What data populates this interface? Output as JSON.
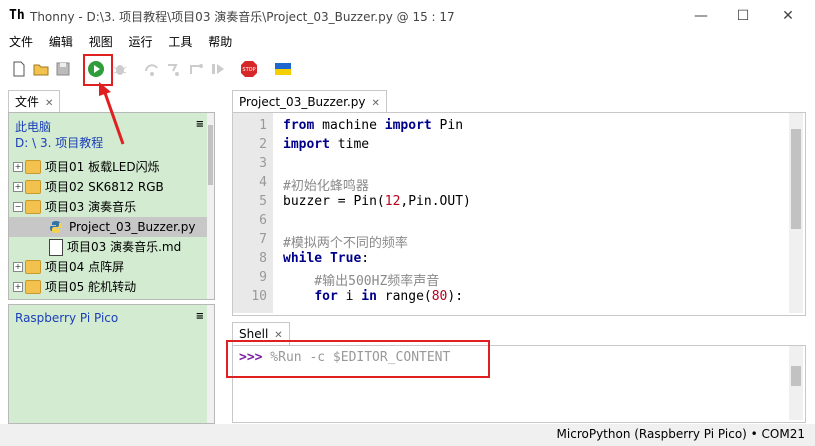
{
  "window": {
    "title": "Thonny  -  D:\\3. 项目教程\\项目03 演奏音乐\\Project_03_Buzzer.py  @  15 : 17",
    "app_icon": "Th"
  },
  "menu": [
    "文件",
    "编辑",
    "视图",
    "运行",
    "工具",
    "帮助"
  ],
  "toolbar_icons": [
    "new-file-icon",
    "open-file-icon",
    "save-icon",
    "run-icon",
    "debug-icon",
    "step-over-icon",
    "step-into-icon",
    "step-out-icon",
    "resume-icon",
    "stop-icon",
    "ukraine-flag-icon"
  ],
  "files_panel": {
    "tab": "文件",
    "header_line1": "此电脑",
    "header_line2": "D: \\ 3. 项目教程",
    "items": [
      {
        "label": "项目01 板载LED闪烁",
        "type": "folder",
        "expander": "+"
      },
      {
        "label": "项目02 SK6812 RGB",
        "type": "folder",
        "expander": "+"
      },
      {
        "label": "项目03 演奏音乐",
        "type": "folder",
        "expander": "−"
      },
      {
        "label": "Project_03_Buzzer.py",
        "type": "py",
        "selected": true
      },
      {
        "label": "项目03 演奏音乐.md",
        "type": "md"
      },
      {
        "label": "项目04 点阵屏",
        "type": "folder",
        "expander": "+"
      },
      {
        "label": "项目05 舵机转动",
        "type": "folder",
        "expander": "+"
      }
    ],
    "menu_glyph": "≡"
  },
  "pico_panel": {
    "header": "Raspberry Pi Pico",
    "menu_glyph": "≡"
  },
  "editor": {
    "tab": "Project_03_Buzzer.py",
    "line_numbers": [
      "1",
      "2",
      "3",
      "4",
      "5",
      "6",
      "7",
      "8",
      "9",
      "10"
    ],
    "lines": {
      "l1a": "from",
      "l1b": " machine ",
      "l1c": "import",
      "l1d": " Pin",
      "l2a": "import",
      "l2b": " time",
      "l4": "#初始化蜂鸣器",
      "l5a": "buzzer = Pin(",
      "l5b": "12",
      "l5c": ",Pin.OUT)",
      "l7": "#模拟两个不同的频率",
      "l8a": "while",
      "l8b": " ",
      "l8c": "True",
      "l8d": ":",
      "l9": "    #输出500HZ频率声音",
      "l10a": "    ",
      "l10b": "for",
      "l10c": " i ",
      "l10d": "in",
      "l10e": " range(",
      "l10f": "80",
      "l10g": "):"
    }
  },
  "shell": {
    "tab": "Shell",
    "prompt": ">>>",
    "command": " %Run -c $EDITOR_CONTENT"
  },
  "status": "MicroPython (Raspberry Pi Pico)  •  COM21",
  "colors": {
    "accent_red": "#e02020",
    "panel_green": "#d2ebd1"
  }
}
